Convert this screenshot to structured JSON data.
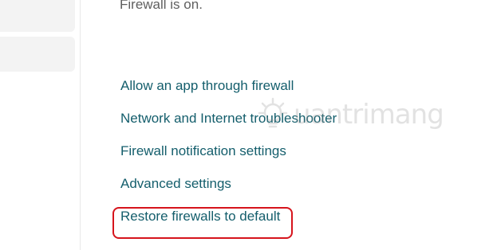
{
  "status": {
    "text": "Firewall is on."
  },
  "links": [
    {
      "label": "Allow an app through firewall"
    },
    {
      "label": "Network and Internet troubleshooter"
    },
    {
      "label": "Firewall notification settings"
    },
    {
      "label": "Advanced settings"
    },
    {
      "label": "Restore firewalls to default"
    }
  ],
  "watermark": {
    "text": "uantrimang",
    "icon": "lightbulb-logo-icon"
  },
  "colors": {
    "link": "#145e6c",
    "status_text": "#5f5f5f",
    "highlight": "#d6141c",
    "sidebar_item_bg": "#f3f3f3"
  }
}
